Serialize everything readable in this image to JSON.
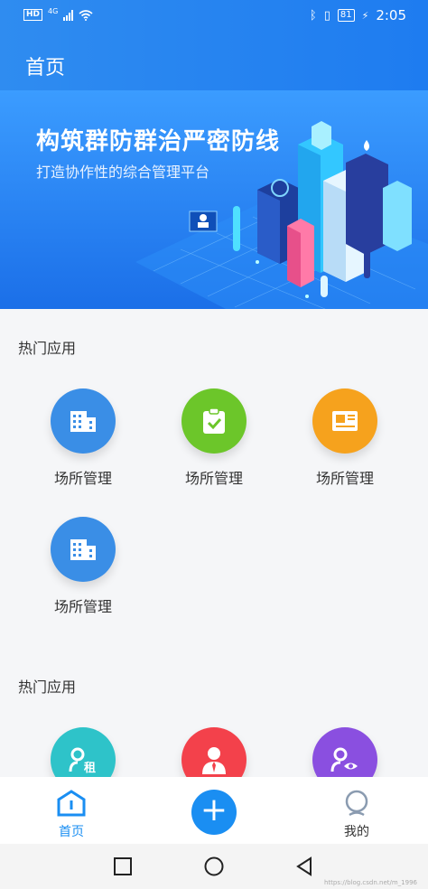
{
  "status_bar": {
    "network_label": "HD",
    "network_type": "4G",
    "battery": "81",
    "time": "2:05"
  },
  "header": {
    "title": "首页"
  },
  "banner": {
    "title": "构筑群防群治严密防线",
    "subtitle": "打造协作性的综合管理平台"
  },
  "sections": [
    {
      "title": "热门应用",
      "apps": [
        {
          "label": "场所管理",
          "icon": "building-icon",
          "color": "#3a8ee6"
        },
        {
          "label": "场所管理",
          "icon": "clipboard-check-icon",
          "color": "#6cc62a"
        },
        {
          "label": "场所管理",
          "icon": "newspaper-icon",
          "color": "#f6a21d"
        },
        {
          "label": "场所管理",
          "icon": "building-icon",
          "color": "#3a8ee6"
        }
      ]
    },
    {
      "title": "热门应用",
      "apps": [
        {
          "icon": "rent-user-icon",
          "color": "#2ec3c9",
          "badge": "租"
        },
        {
          "icon": "person-tie-icon",
          "color": "#f3414b"
        },
        {
          "icon": "user-eye-icon",
          "color": "#8a4fe0"
        }
      ]
    }
  ],
  "tabbar": {
    "home_label": "首页",
    "mine_label": "我的",
    "active_color": "#1a8ef2"
  },
  "watermark": "https://blog.csdn.net/m_1996"
}
